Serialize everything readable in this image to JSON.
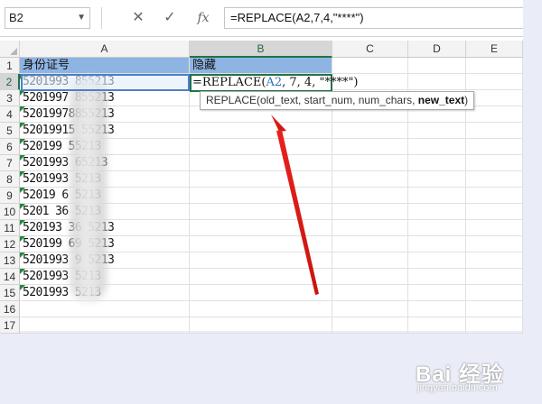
{
  "formula_bar": {
    "name_box": "B2",
    "name_box_arrow": "▼",
    "cancel_symbol": "✕",
    "enter_symbol": "✓",
    "fx_label": "fx",
    "formula": "=REPLACE(A2,7,4,\"****\")"
  },
  "columns": [
    "A",
    "B",
    "C",
    "D",
    "E"
  ],
  "rows": [
    {
      "num": "1",
      "a": "身份证号",
      "b": "隐藏"
    },
    {
      "num": "2",
      "a": "5201993  855213",
      "b": ""
    },
    {
      "num": "3",
      "a": "5201997  855213",
      "b": ""
    },
    {
      "num": "4",
      "a": "52019978855213",
      "b": ""
    },
    {
      "num": "5",
      "a": "52019915 55213",
      "b": ""
    },
    {
      "num": "6",
      "a": "520199   55213",
      "b": ""
    },
    {
      "num": "7",
      "a": "5201993   65213",
      "b": ""
    },
    {
      "num": "8",
      "a": "5201993   5213",
      "b": ""
    },
    {
      "num": "9",
      "a": "52019    6   5213",
      "b": ""
    },
    {
      "num": "10",
      "a": "5201  36   5213",
      "b": ""
    },
    {
      "num": "11",
      "a": "520193   36   5213",
      "b": ""
    },
    {
      "num": "12",
      "a": "520199   69   5213",
      "b": ""
    },
    {
      "num": "13",
      "a": "5201993   9   5213",
      "b": ""
    },
    {
      "num": "14",
      "a": "5201993   5213",
      "b": ""
    },
    {
      "num": "15",
      "a": "5201993   5213",
      "b": ""
    },
    {
      "num": "16",
      "a": "",
      "b": ""
    },
    {
      "num": "17",
      "a": "",
      "b": ""
    }
  ],
  "editing": {
    "prefix": "=REPLACE(",
    "ref": "A2",
    "rest": ", 7, 4, \"****\")"
  },
  "tooltip": {
    "args": "REPLACE(old_text, start_num, num_chars, ",
    "bold_arg": "new_text",
    "close": ")"
  },
  "watermark": {
    "title": "Bai 经验",
    "sub": "jingyan.baidu.com"
  },
  "colors": {
    "header_fill": "#8eb4e3",
    "accent_green": "#217346",
    "arrow_red": "#e0201b"
  }
}
